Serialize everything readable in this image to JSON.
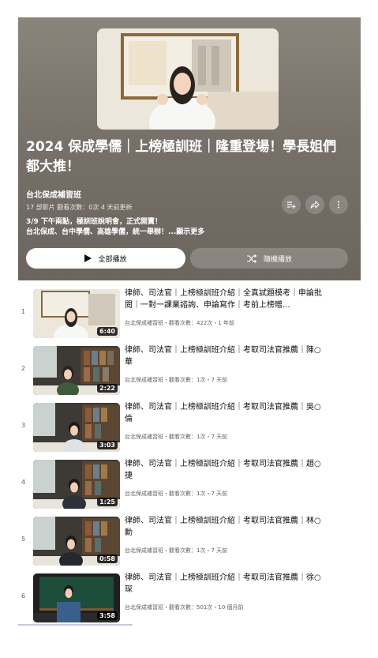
{
  "playlist": {
    "title": "2024 保成學儒｜上榜極訓班｜隆重登場！學長姐們都大推！",
    "channel": "台北保成補習班",
    "stats": "17 部影片  觀看次數：0次  4 天前更新",
    "desc_line1": "3/9 下午兩點，極訓班說明會，正式開賣！",
    "desc_line2": "台北保成、台中學儒、高雄學儒，統一舉辦！",
    "more": "...顯示更多",
    "play_all": "全部播放",
    "shuffle": "隨機播放"
  },
  "videos": [
    {
      "index": "1",
      "title": "律師、司法官｜上榜極訓班介紹｜全真試題模考｜申論批閱｜一對一課業諮詢、申論寫作｜考前上榜贈...",
      "meta": "台北保成補習班・觀看次數：422次・1 年前",
      "duration": "6:40"
    },
    {
      "index": "2",
      "title": "律師、司法官｜上榜極訓班介紹｜考取司法官推薦｜陳○華",
      "meta": "台北保成補習班・觀看次數：1次・7 天前",
      "duration": "2:22"
    },
    {
      "index": "3",
      "title": "律師、司法官｜上榜極訓班介紹｜考取司法官推薦｜吳○倫",
      "meta": "台北保成補習班・觀看次數：1次・7 天前",
      "duration": "3:03"
    },
    {
      "index": "4",
      "title": "律師、司法官｜上榜極訓班介紹｜考取司法官推薦｜趙○捷",
      "meta": "台北保成補習班・觀看次數：1次・7 天前",
      "duration": "1:25"
    },
    {
      "index": "5",
      "title": "律師、司法官｜上榜極訓班介紹｜考取司法官推薦｜林○勳",
      "meta": "台北保成補習班・觀看次數：1次・7 天前",
      "duration": "0:58"
    },
    {
      "index": "6",
      "title": "律師、司法官｜上榜極訓班介紹｜考取司法官推薦｜徐○琛",
      "meta": "台北保成補習班・觀看次數：501次・10 個月前",
      "duration": "3:58"
    }
  ]
}
